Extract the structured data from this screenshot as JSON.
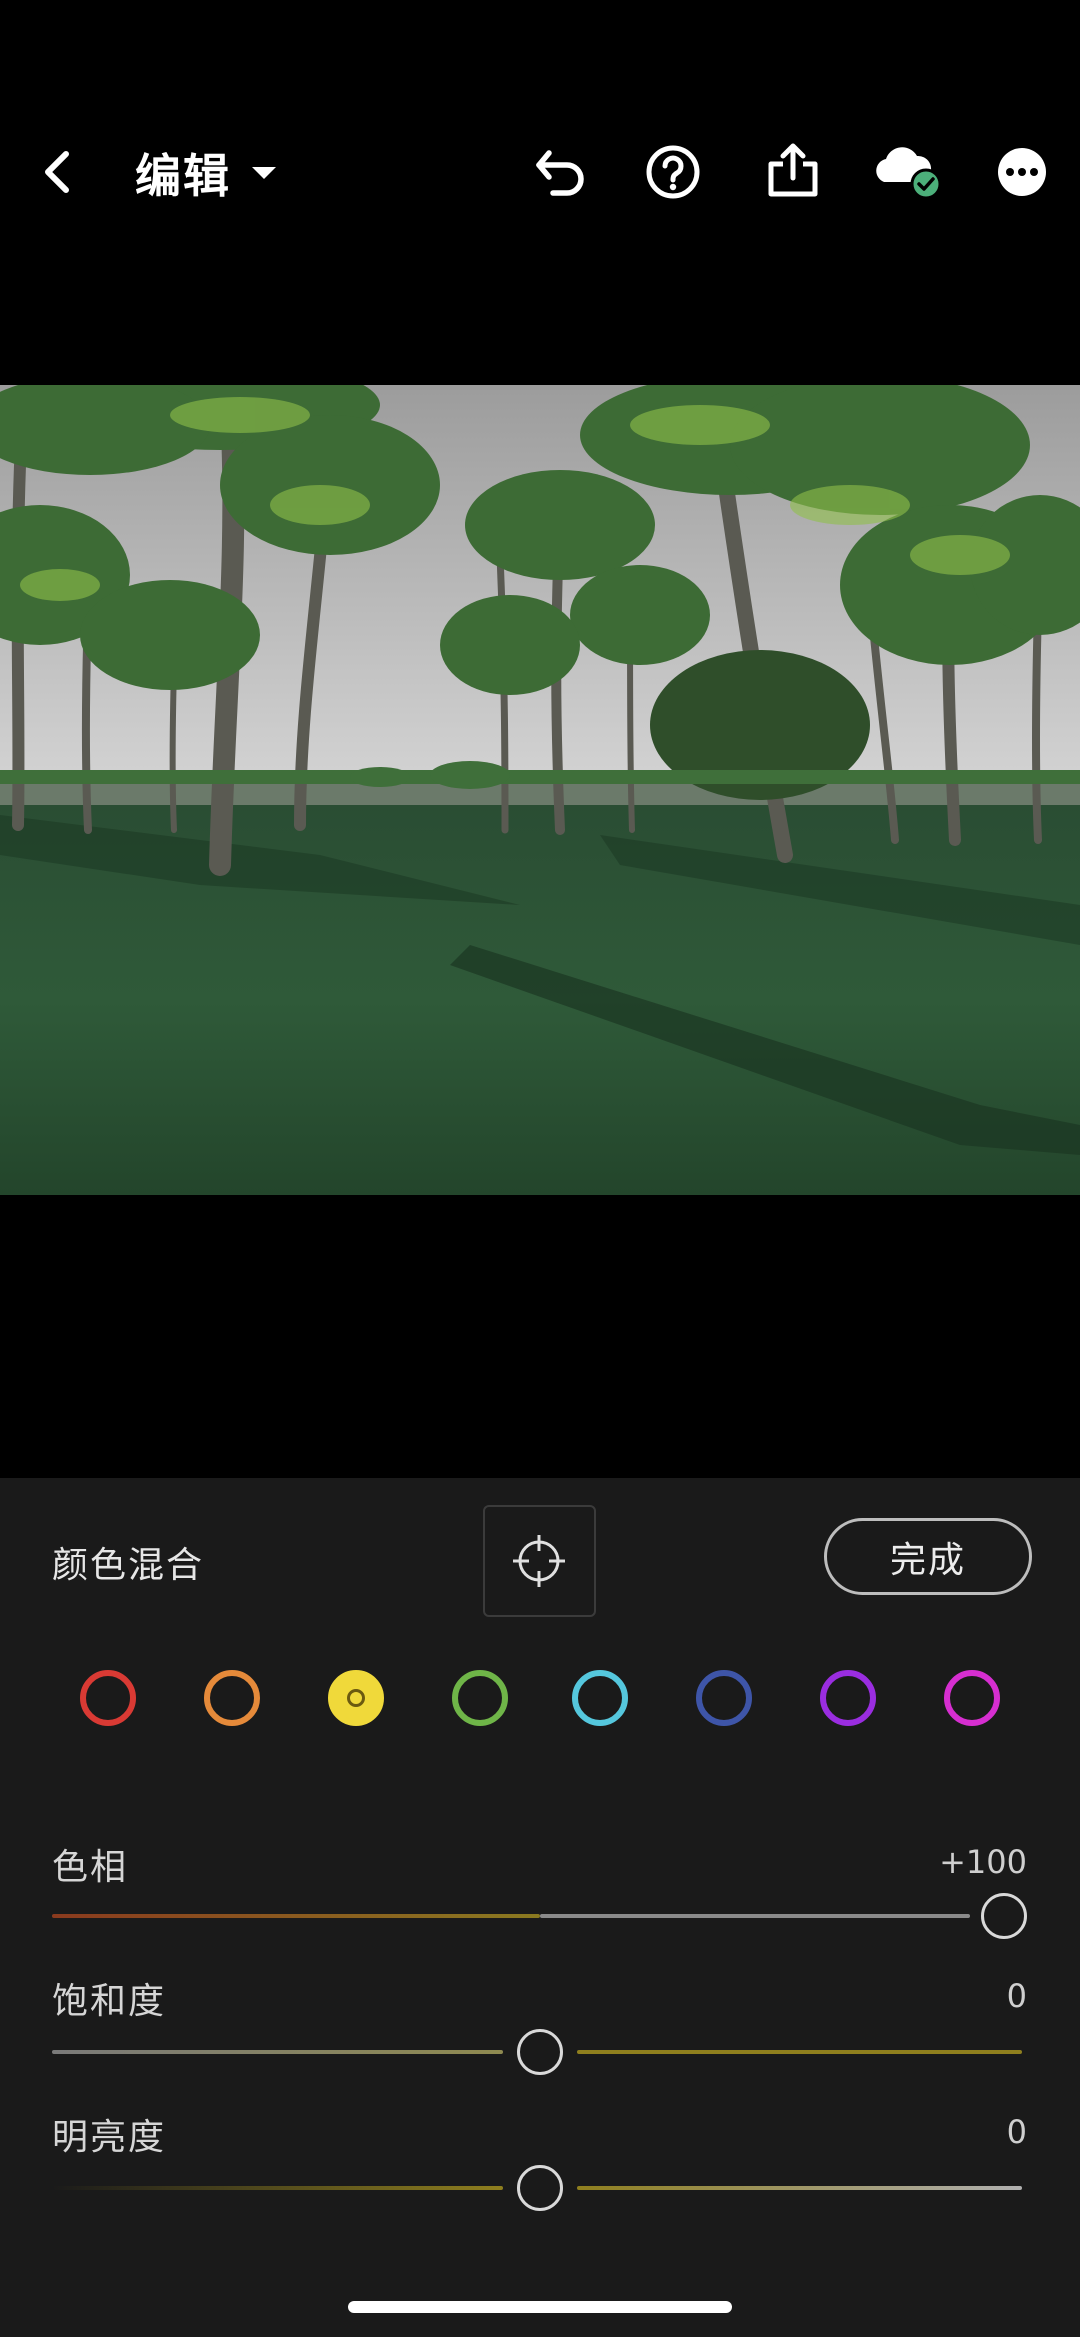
{
  "header": {
    "title": "编辑",
    "icons": [
      "back-arrow-icon",
      "chevron-down-icon",
      "undo-icon",
      "help-icon",
      "share-icon",
      "cloud-synced-icon",
      "more-icon"
    ]
  },
  "panel": {
    "title": "颜色混合",
    "done_label": "完成",
    "swatches": [
      {
        "name": "red",
        "color": "#d93a34",
        "selected": false
      },
      {
        "name": "orange",
        "color": "#e58a3a",
        "selected": false
      },
      {
        "name": "yellow",
        "color": "#f0d93a",
        "selected": true
      },
      {
        "name": "green",
        "color": "#6fb548",
        "selected": false
      },
      {
        "name": "aqua",
        "color": "#55c7dd",
        "selected": false
      },
      {
        "name": "blue",
        "color": "#3e55a8",
        "selected": false
      },
      {
        "name": "purple",
        "color": "#9a2de0",
        "selected": false
      },
      {
        "name": "magenta",
        "color": "#d62ed0",
        "selected": false
      }
    ],
    "sliders": [
      {
        "label": "色相",
        "value": "+100",
        "level": 100
      },
      {
        "label": "饱和度",
        "value": "0",
        "level": 0
      },
      {
        "label": "明亮度",
        "value": "0",
        "level": 0
      }
    ]
  },
  "colors": {
    "accent_synced": "#4caf7a",
    "track_gray": "#8a8a8a",
    "track_yellow": "#8f7f1e"
  }
}
